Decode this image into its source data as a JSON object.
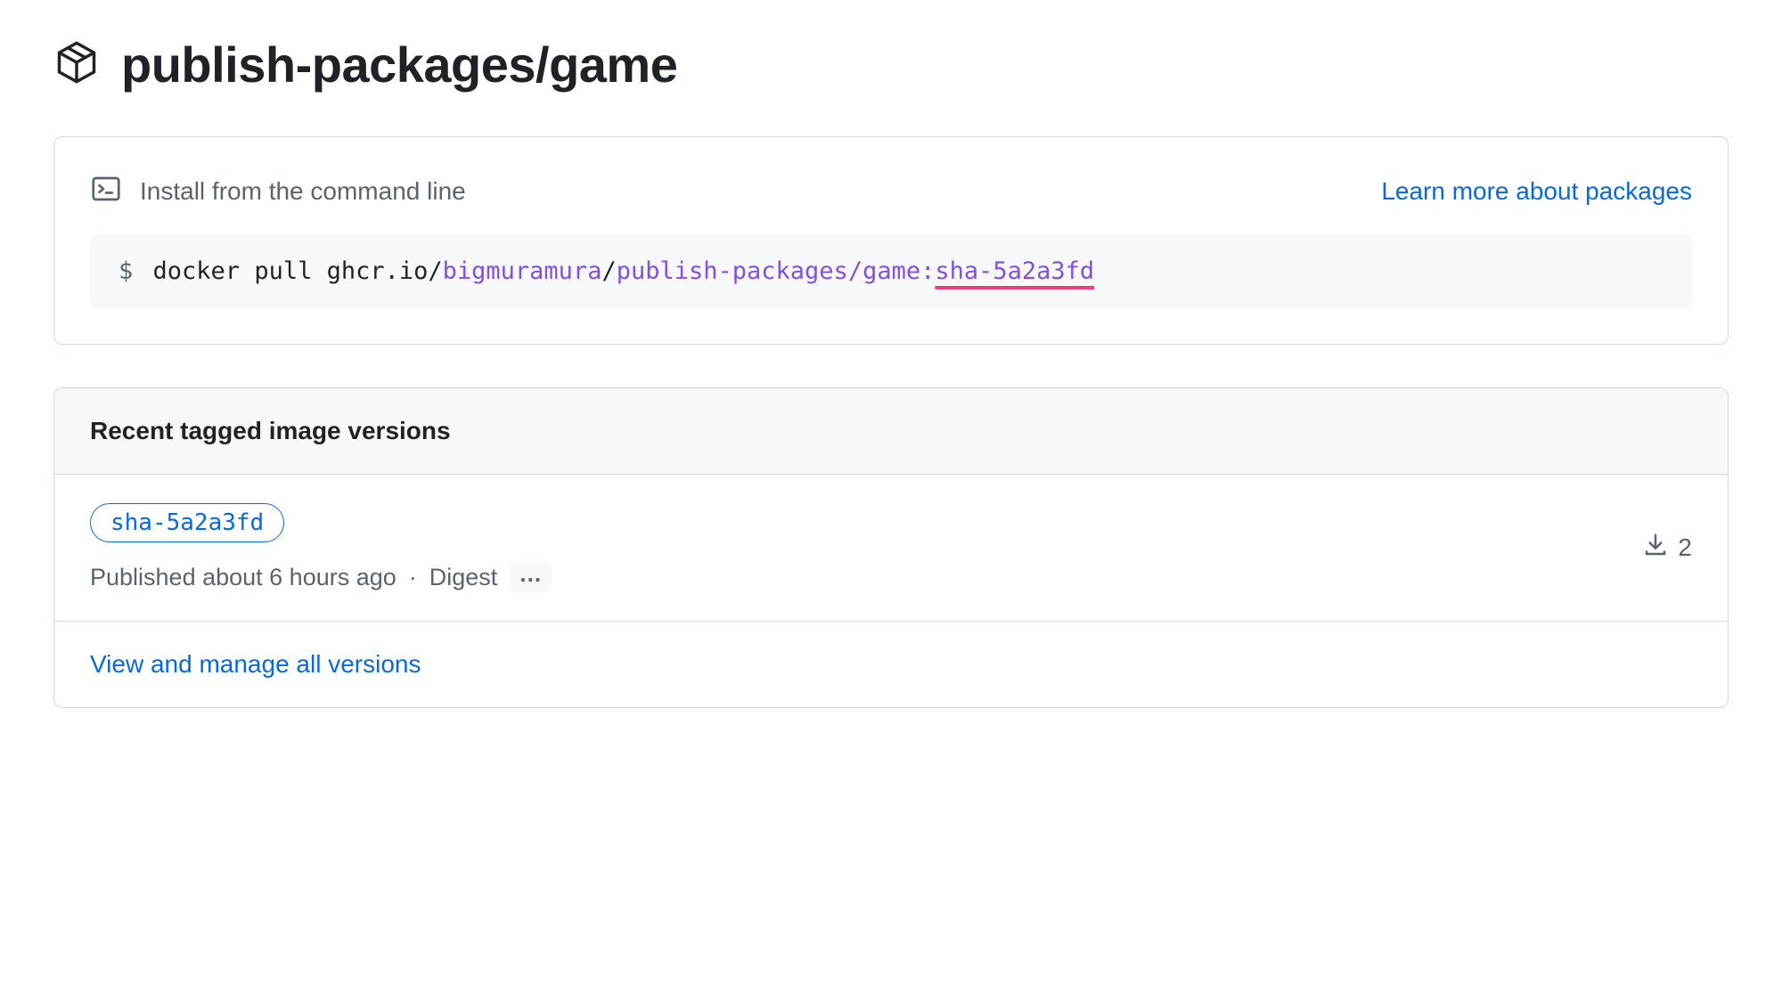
{
  "header": {
    "title": "publish-packages/game"
  },
  "install": {
    "label": "Install from the command line",
    "learn_more": "Learn more about packages",
    "command": {
      "prompt": "$",
      "cmd": "docker pull ghcr.io/",
      "user": "bigmuramura",
      "sep1": "/",
      "repo": "publish-packages",
      "sep2": "/",
      "pkg": "game",
      "colon": ":",
      "sha": "sha-5a2a3fd"
    }
  },
  "versions": {
    "heading": "Recent tagged image versions",
    "items": [
      {
        "tag": "sha-5a2a3fd",
        "published": "Published about 6 hours ago",
        "digest_label": "Digest",
        "downloads": "2"
      }
    ],
    "footer_link": "View and manage all versions"
  }
}
